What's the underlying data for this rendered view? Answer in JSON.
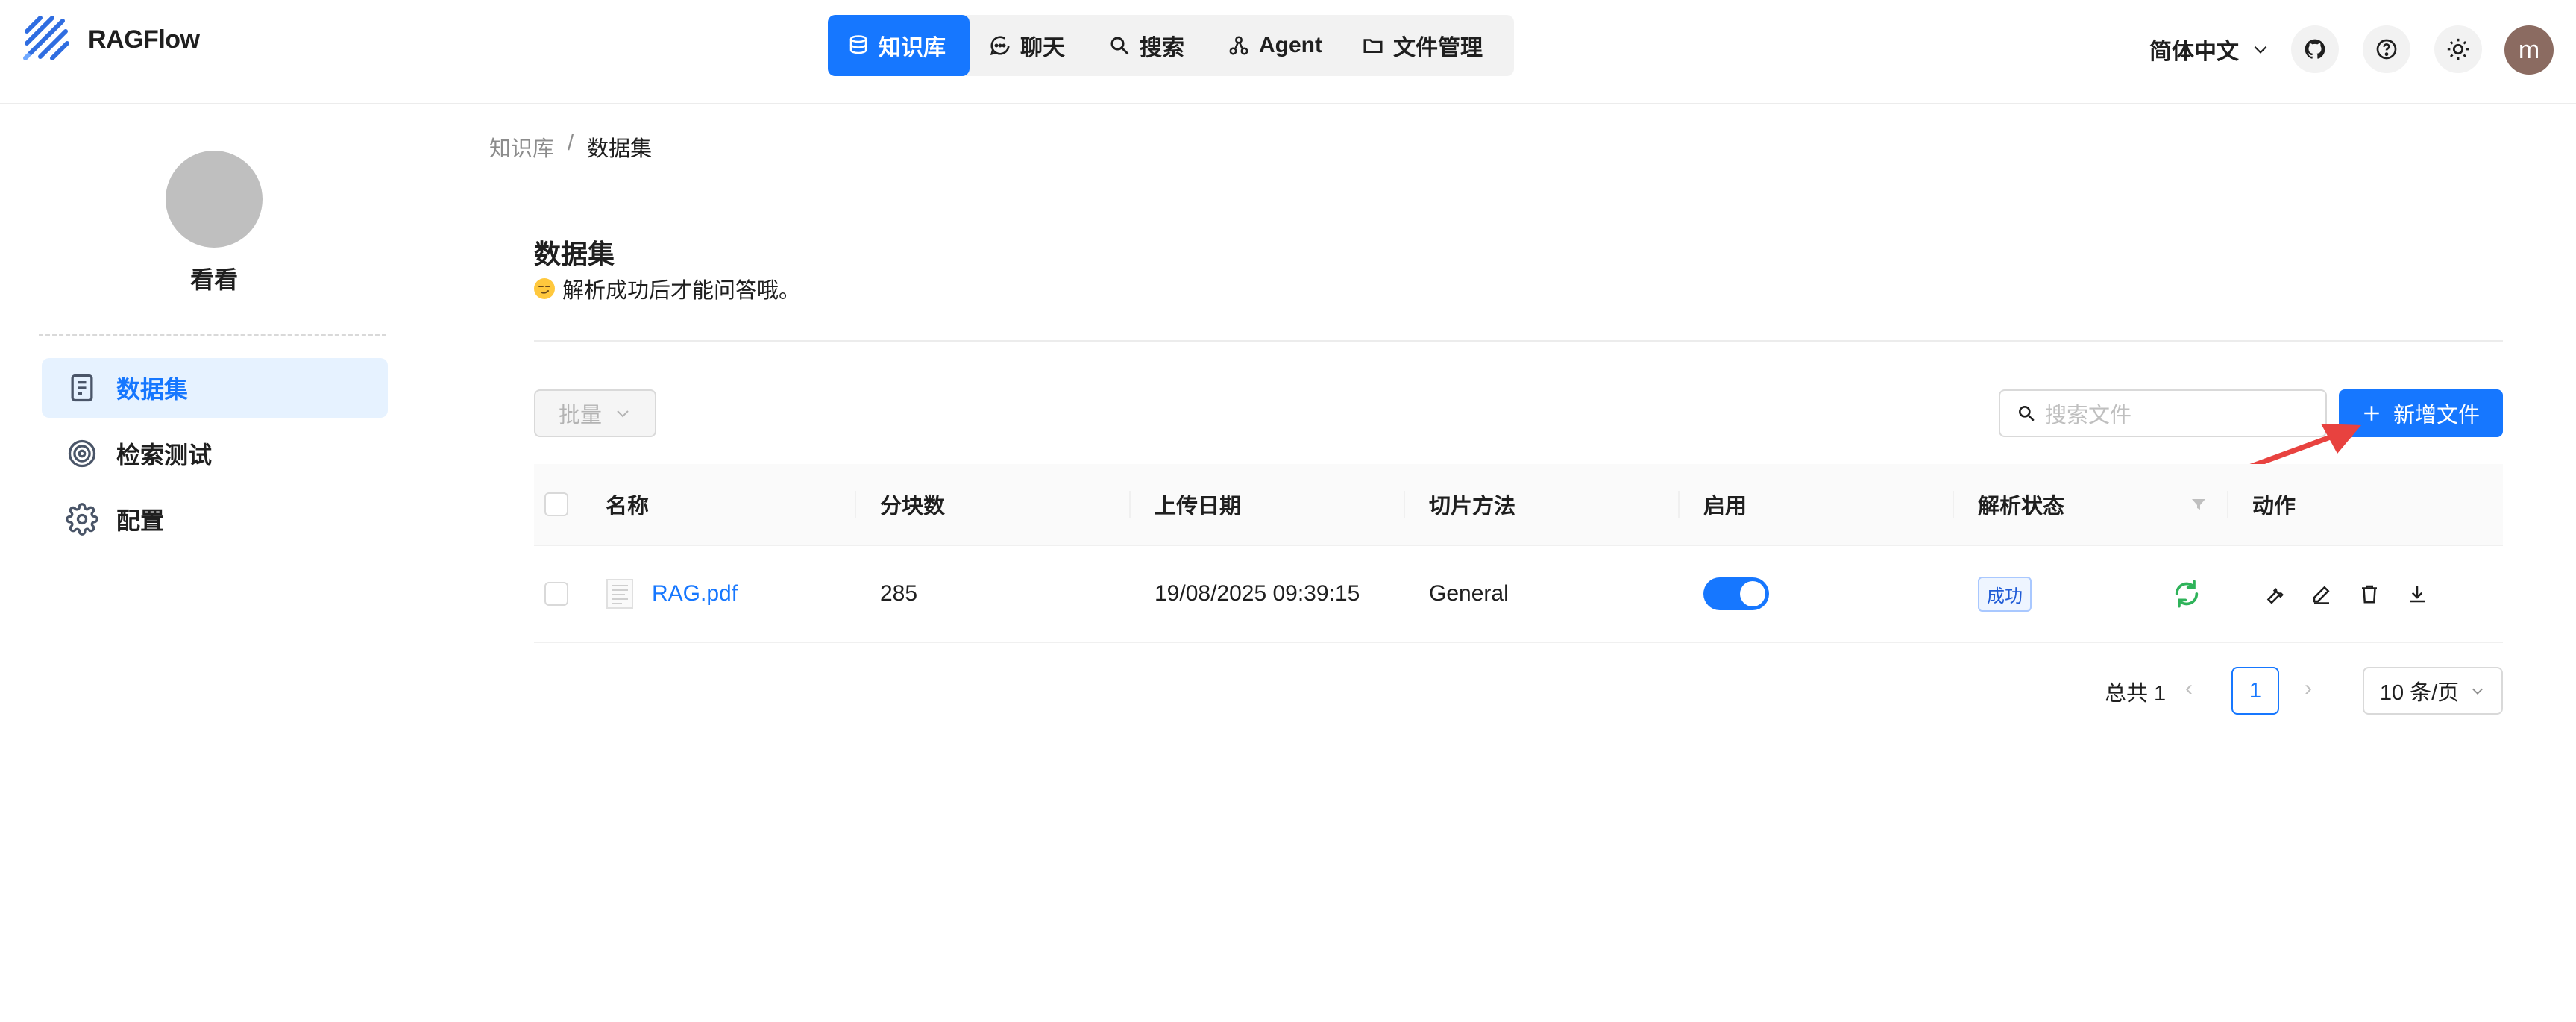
{
  "app": {
    "name": "RAGFlow"
  },
  "nav": {
    "items": [
      {
        "label": "知识库",
        "icon": "database-icon",
        "active": true
      },
      {
        "label": "聊天",
        "icon": "chat-icon",
        "active": false
      },
      {
        "label": "搜索",
        "icon": "search-icon",
        "active": false
      },
      {
        "label": "Agent",
        "icon": "agent-icon",
        "active": false
      },
      {
        "label": "文件管理",
        "icon": "folder-icon",
        "active": false
      }
    ]
  },
  "header": {
    "language": "简体中文",
    "user_initial": "m"
  },
  "sidebar": {
    "name": "看看",
    "items": [
      {
        "label": "数据集",
        "icon": "document-icon",
        "active": true
      },
      {
        "label": "检索测试",
        "icon": "target-icon",
        "active": false
      },
      {
        "label": "配置",
        "icon": "gear-icon",
        "active": false
      }
    ]
  },
  "breadcrumb": {
    "root": "知识库",
    "separator": "/",
    "current": "数据集"
  },
  "main": {
    "title": "数据集",
    "description": "解析成功后才能问答哦。",
    "batch_label": "批量",
    "search_placeholder": "搜索文件",
    "add_label": "新增文件"
  },
  "table": {
    "columns": [
      "名称",
      "分块数",
      "上传日期",
      "切片方法",
      "启用",
      "解析状态",
      "动作"
    ],
    "rows": [
      {
        "name": "RAG.pdf",
        "chunks": "285",
        "date": "19/08/2025 09:39:15",
        "method": "General",
        "enabled": true,
        "status": "成功"
      }
    ]
  },
  "pagination": {
    "total": "总共 1",
    "current": "1",
    "page_size": "10 条/页"
  },
  "colors": {
    "primary": "#1677ff",
    "success": "#2fb35a",
    "arrow": "#e8423f"
  }
}
